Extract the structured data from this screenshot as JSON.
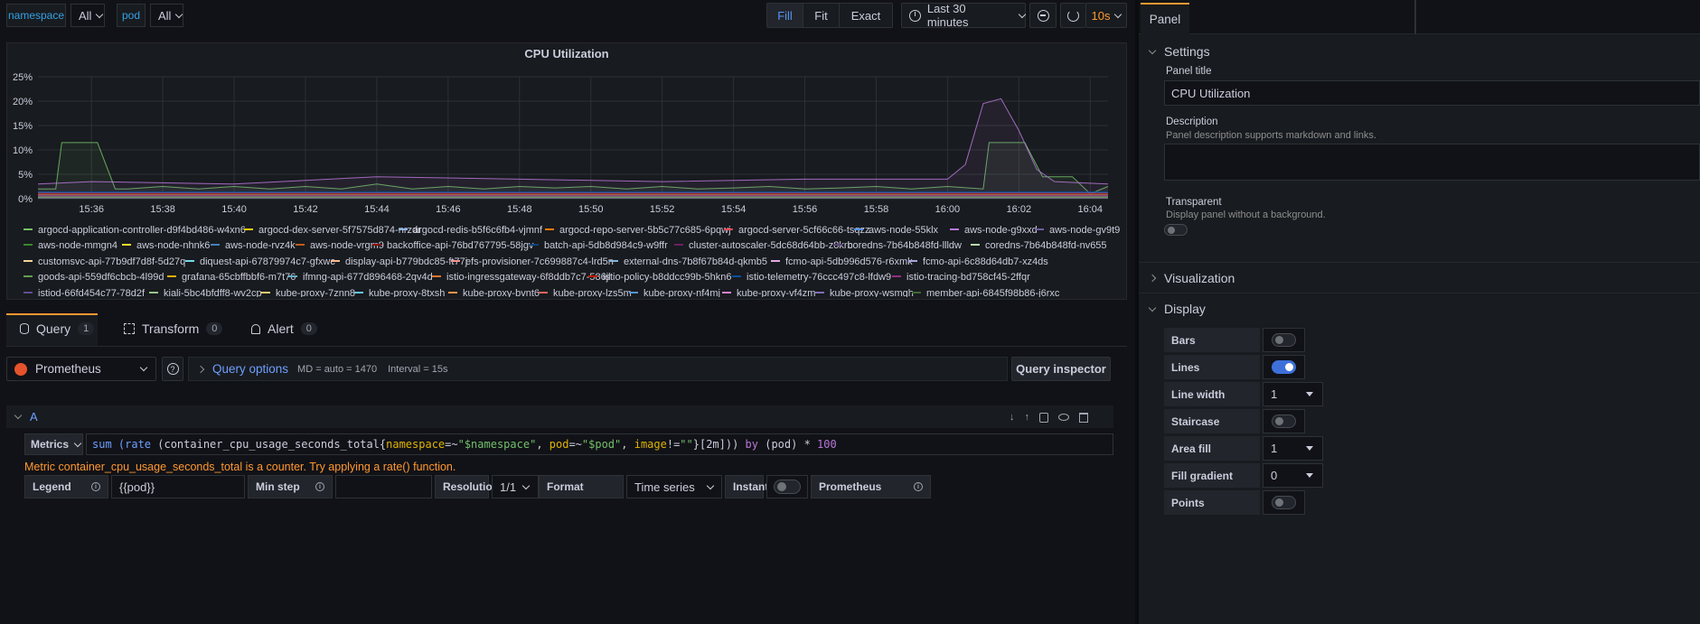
{
  "toolbar": {
    "namespace_label": "namespace",
    "namespace_value": "All",
    "pod_label": "pod",
    "pod_value": "All",
    "fill": "Fill",
    "fit": "Fit",
    "exact": "Exact",
    "time_range": "Last 30 minutes",
    "refresh_interval": "10s"
  },
  "panel": {
    "title": "CPU Utilization"
  },
  "chart_data": {
    "type": "line",
    "title": "CPU Utilization",
    "y_ticks": [
      "25%",
      "20%",
      "15%",
      "10%",
      "5%",
      "0%"
    ],
    "x_ticks": [
      "15:36",
      "15:38",
      "15:40",
      "15:42",
      "15:44",
      "15:46",
      "15:48",
      "15:50",
      "15:52",
      "15:54",
      "15:56",
      "15:58",
      "16:00",
      "16:02",
      "16:04"
    ],
    "ylim": [
      0,
      25
    ],
    "xlim": [
      "15:34:30",
      "16:04:30"
    ],
    "grid": true,
    "legend_placement": "bottom",
    "series": [
      {
        "name": "argocd-application-controller-d9f4bd486-w4xn6",
        "color": "#73bf69",
        "x": [
          "15:34:30",
          "15:35:00",
          "15:35:10",
          "15:35:40",
          "15:36:10",
          "15:36:40",
          "15:37:00",
          "15:38:00",
          "15:39:00",
          "15:40:00",
          "15:41:00",
          "15:42:00",
          "15:43:00",
          "15:44:00",
          "15:45:00",
          "15:46:00",
          "15:47:00",
          "15:48:00",
          "15:49:00",
          "15:50:00",
          "15:51:00",
          "15:52:00",
          "15:53:00",
          "15:54:00",
          "15:55:00",
          "15:56:00",
          "15:57:00",
          "15:58:00",
          "15:59:00",
          "16:00:00",
          "16:01:00",
          "16:01:10",
          "16:01:40",
          "16:02:10",
          "16:02:40",
          "16:03:00",
          "16:03:30",
          "16:04:00",
          "16:04:30"
        ],
        "y": [
          2,
          2,
          11.5,
          11.5,
          11.5,
          2,
          2,
          2.5,
          2,
          2.5,
          2,
          2.5,
          2,
          3,
          2,
          2.5,
          2,
          2.5,
          2.2,
          2.5,
          2,
          2.5,
          2,
          2.2,
          2.5,
          2,
          2.2,
          2.5,
          2,
          2.5,
          2,
          11.5,
          11.5,
          11.5,
          4.5,
          4.5,
          4.5,
          1,
          2.5
        ]
      },
      {
        "name": "argocd-dex-server-5f7575d874-nrzdr",
        "color": "#f2cc0c",
        "x": [
          "15:34:30",
          "16:04:30"
        ],
        "y": [
          0.3,
          0.3
        ]
      },
      {
        "name": "argocd-redis-b5f6c6fb4-vjmnf",
        "color": "#8ab8ff",
        "x": [
          "15:34:30",
          "16:04:30"
        ],
        "y": [
          0.2,
          0.2
        ]
      },
      {
        "name": "argocd-repo-server-5b5c77c685-6pqwj",
        "color": "#ff780a",
        "x": [
          "15:34:30",
          "15:50:00",
          "15:56:00",
          "16:04:30"
        ],
        "y": [
          0.6,
          0.8,
          0.7,
          0.6
        ]
      },
      {
        "name": "argocd-server-5cf66c66-tsqzz",
        "color": "#f2495c",
        "x": [
          "15:34:30",
          "16:04:30"
        ],
        "y": [
          0.5,
          0.5
        ]
      },
      {
        "name": "aws-node-55klx",
        "color": "#5794f2",
        "x": [
          "15:34:30",
          "16:04:30"
        ],
        "y": [
          0.4,
          0.4
        ]
      },
      {
        "name": "aws-node-g9xxd",
        "color": "#b877d9",
        "x": [
          "15:34:30",
          "15:36:00",
          "15:40:00",
          "15:44:00",
          "15:48:00",
          "15:52:00",
          "15:56:00",
          "16:00:00",
          "16:00:30",
          "16:01:00",
          "16:01:30",
          "16:02:00",
          "16:02:30",
          "16:03:00",
          "16:04:30"
        ],
        "y": [
          3,
          3.5,
          3,
          4.5,
          4,
          3.5,
          4,
          4,
          7,
          19.5,
          20.5,
          14,
          6,
          3.5,
          3
        ]
      },
      {
        "name": "aws-node-gv9t9",
        "color": "#705da0",
        "x": [
          "15:34:30",
          "16:04:30"
        ],
        "y": [
          1.2,
          1.2
        ]
      },
      {
        "name": "aws-node-mmgn4",
        "color": "#37872d",
        "x": [
          "15:34:30",
          "16:04:30"
        ],
        "y": [
          0.7,
          0.7
        ]
      },
      {
        "name": "aws-node-nhnk6",
        "color": "#fade2a",
        "x": [
          "15:34:30",
          "16:04:30"
        ],
        "y": [
          0.9,
          0.9
        ]
      },
      {
        "name": "aws-node-rvz4k",
        "color": "#447ebc",
        "x": [
          "15:34:30",
          "16:04:30"
        ],
        "y": [
          0.8,
          0.8
        ]
      },
      {
        "name": "aws-node-vrgm9",
        "color": "#c15c17",
        "x": [
          "15:34:30",
          "16:04:30"
        ],
        "y": [
          0.6,
          0.6
        ]
      },
      {
        "name": "backoffice-api-76bd767795-58jgv",
        "color": "#890f02",
        "x": [
          "15:34:30",
          "16:04:30"
        ],
        "y": [
          0.3,
          0.3
        ]
      },
      {
        "name": "batch-api-5db8d984c9-w9ffr",
        "color": "#0a437c",
        "x": [
          "15:34:30",
          "16:04:30"
        ],
        "y": [
          0.2,
          0.2
        ]
      },
      {
        "name": "cluster-autoscaler-5dc68d64bb-z8krb",
        "color": "#6d1f62",
        "x": [
          "15:34:30",
          "16:04:30"
        ],
        "y": [
          0.5,
          0.5
        ]
      },
      {
        "name": "coredns-7b64b848fd-llldw",
        "color": "#584477",
        "x": [
          "15:34:30",
          "16:04:30"
        ],
        "y": [
          0.3,
          0.3
        ]
      },
      {
        "name": "coredns-7b64b848fd-nv655",
        "color": "#b7dbab",
        "x": [
          "15:34:30",
          "16:04:30"
        ],
        "y": [
          0.3,
          0.3
        ]
      },
      {
        "name": "customsvc-api-77b9df7d8f-5d27q",
        "color": "#f4d598",
        "x": [
          "15:34:30",
          "16:04:30"
        ],
        "y": [
          0.2,
          0.2
        ]
      },
      {
        "name": "diquest-api-67879974c7-gfxwc",
        "color": "#70dbed",
        "x": [
          "15:34:30",
          "16:04:30"
        ],
        "y": [
          0.2,
          0.2
        ]
      },
      {
        "name": "display-api-b779bdc85-ft77j",
        "color": "#f9ba8f",
        "x": [
          "15:34:30",
          "16:04:30"
        ],
        "y": [
          0.2,
          0.2
        ]
      },
      {
        "name": "efs-provisioner-7c699887c4-lrd5n",
        "color": "#f29191",
        "x": [
          "15:34:30",
          "16:04:30"
        ],
        "y": [
          0.1,
          0.1
        ]
      },
      {
        "name": "external-dns-7b8f67b84d-qkmb5",
        "color": "#82b5d8",
        "x": [
          "15:34:30",
          "16:04:30"
        ],
        "y": [
          0.1,
          0.1
        ]
      },
      {
        "name": "fcmo-api-5db996d576-r6xmk",
        "color": "#e5a8e2",
        "x": [
          "15:34:30",
          "16:04:30"
        ],
        "y": [
          0.2,
          0.2
        ]
      },
      {
        "name": "fcmo-api-6c88d64db7-xz4ds",
        "color": "#aea2e0",
        "x": [
          "15:34:30",
          "16:04:30"
        ],
        "y": [
          0.2,
          0.2
        ]
      },
      {
        "name": "goods-api-559df6cbcb-4l99d",
        "color": "#629e51",
        "x": [
          "15:34:30",
          "16:04:30"
        ],
        "y": [
          0.3,
          0.3
        ]
      },
      {
        "name": "grafana-65cbffbbf6-m7t76",
        "color": "#e5ac0e",
        "x": [
          "15:34:30",
          "16:04:30"
        ],
        "y": [
          0.4,
          0.4
        ]
      },
      {
        "name": "ifmng-api-677d896468-2qv4d",
        "color": "#64b0c8",
        "x": [
          "15:34:30",
          "16:04:30"
        ],
        "y": [
          0.2,
          0.2
        ]
      },
      {
        "name": "istio-ingressgateway-6f8ddb7c7-586jl",
        "color": "#e0752d",
        "x": [
          "15:34:30",
          "16:04:30"
        ],
        "y": [
          0.9,
          0.9
        ]
      },
      {
        "name": "istio-policy-b8ddcc99b-5hkn6",
        "color": "#bf1b00",
        "x": [
          "15:34:30",
          "16:04:30"
        ],
        "y": [
          1.0,
          1.0
        ]
      },
      {
        "name": "istio-telemetry-76ccc497c8-lfdw9",
        "color": "#0a50a1",
        "x": [
          "15:34:30",
          "16:04:30"
        ],
        "y": [
          1.4,
          1.4
        ]
      },
      {
        "name": "istio-tracing-bd758cf45-2ffqr",
        "color": "#962d82",
        "x": [
          "15:34:30",
          "16:04:30"
        ],
        "y": [
          0.6,
          0.6
        ]
      },
      {
        "name": "istiod-66fd454c77-78d2f",
        "color": "#614d93",
        "x": [
          "15:34:30",
          "16:04:30"
        ],
        "y": [
          0.5,
          0.5
        ]
      },
      {
        "name": "kiali-5bc4bfdff8-wv2cp",
        "color": "#9ac48a",
        "x": [
          "15:34:30",
          "16:04:30"
        ],
        "y": [
          0.3,
          0.3
        ]
      },
      {
        "name": "kube-proxy-7znn8",
        "color": "#f2c96d",
        "x": [
          "15:34:30",
          "16:04:30"
        ],
        "y": [
          0.1,
          0.1
        ]
      },
      {
        "name": "kube-proxy-8txsh",
        "color": "#65c5db",
        "x": [
          "15:34:30",
          "16:04:30"
        ],
        "y": [
          0.1,
          0.1
        ]
      },
      {
        "name": "kube-proxy-bvnt6",
        "color": "#f9934e",
        "x": [
          "15:34:30",
          "16:04:30"
        ],
        "y": [
          0.1,
          0.1
        ]
      },
      {
        "name": "kube-proxy-lzs5m",
        "color": "#ea6460",
        "x": [
          "15:34:30",
          "16:04:30"
        ],
        "y": [
          0.1,
          0.1
        ]
      },
      {
        "name": "kube-proxy-nf4mj",
        "color": "#5195ce",
        "x": [
          "15:34:30",
          "16:04:30"
        ],
        "y": [
          0.1,
          0.1
        ]
      },
      {
        "name": "kube-proxy-vf4zm",
        "color": "#d683ce",
        "x": [
          "15:34:30",
          "16:04:30"
        ],
        "y": [
          0.1,
          0.1
        ]
      },
      {
        "name": "kube-proxy-wsmgh",
        "color": "#806eb7",
        "x": [
          "15:34:30",
          "16:04:30"
        ],
        "y": [
          0.1,
          0.1
        ]
      },
      {
        "name": "member-api-6845f98b86-j6rxc",
        "color": "#3f6833",
        "x": [
          "15:34:30",
          "16:04:30"
        ],
        "y": [
          0.2,
          0.2
        ]
      }
    ]
  },
  "query_tabs": [
    {
      "label": "Query",
      "count": "1",
      "icon": "database-icon"
    },
    {
      "label": "Transform",
      "count": "0",
      "icon": "transform-icon"
    },
    {
      "label": "Alert",
      "count": "0",
      "icon": "bell-icon"
    }
  ],
  "query": {
    "datasource": "Prometheus",
    "options_label": "Query options",
    "md_info": "MD = auto = 1470",
    "interval_info": "Interval = 15s",
    "inspector": "Query inspector",
    "ref_id": "A",
    "metrics_label": "Metrics",
    "expression": {
      "p1": "sum (",
      "p2": "rate",
      "p3": " (container_cpu_usage_seconds_total{",
      "p4": "namespace",
      "p5": "=~",
      "p6": "\"$namespace\"",
      "p7": ", ",
      "p8": "pod",
      "p9": "=~",
      "p10": "\"$pod\"",
      "p11": ", ",
      "p12": "image",
      "p13": "!=",
      "p14": "\"\"",
      "p15": "}[2m])) ",
      "p16": "by",
      "p17": " (pod) * ",
      "p18": "100"
    },
    "warning": "Metric container_cpu_usage_seconds_total is a counter. Try applying a rate() function.",
    "legend_label": "Legend",
    "legend_value": "{{pod}}",
    "min_step_label": "Min step",
    "min_step_value": "",
    "resolution_label": "Resolution",
    "resolution_value": "1/1",
    "format_label": "Format",
    "format_value": "Time series",
    "instant_label": "Instant",
    "prometheus_label": "Prometheus"
  },
  "side": {
    "tab": "Panel",
    "settings": "Settings",
    "panel_title_label": "Panel title",
    "panel_title_value": "CPU Utilization",
    "description_label": "Description",
    "description_hint": "Panel description supports markdown and links.",
    "transparent_label": "Transparent",
    "transparent_hint": "Display panel without a background.",
    "visualization": "Visualization",
    "display": "Display",
    "options": [
      {
        "label": "Bars",
        "kind": "toggle",
        "on": false
      },
      {
        "label": "Lines",
        "kind": "toggle",
        "on": true
      },
      {
        "label": "Line width",
        "kind": "select",
        "value": "1"
      },
      {
        "label": "Staircase",
        "kind": "toggle",
        "on": false
      },
      {
        "label": "Area fill",
        "kind": "select",
        "value": "1"
      },
      {
        "label": "Fill gradient",
        "kind": "select",
        "value": "0"
      },
      {
        "label": "Points",
        "kind": "toggle",
        "on": false
      }
    ]
  }
}
